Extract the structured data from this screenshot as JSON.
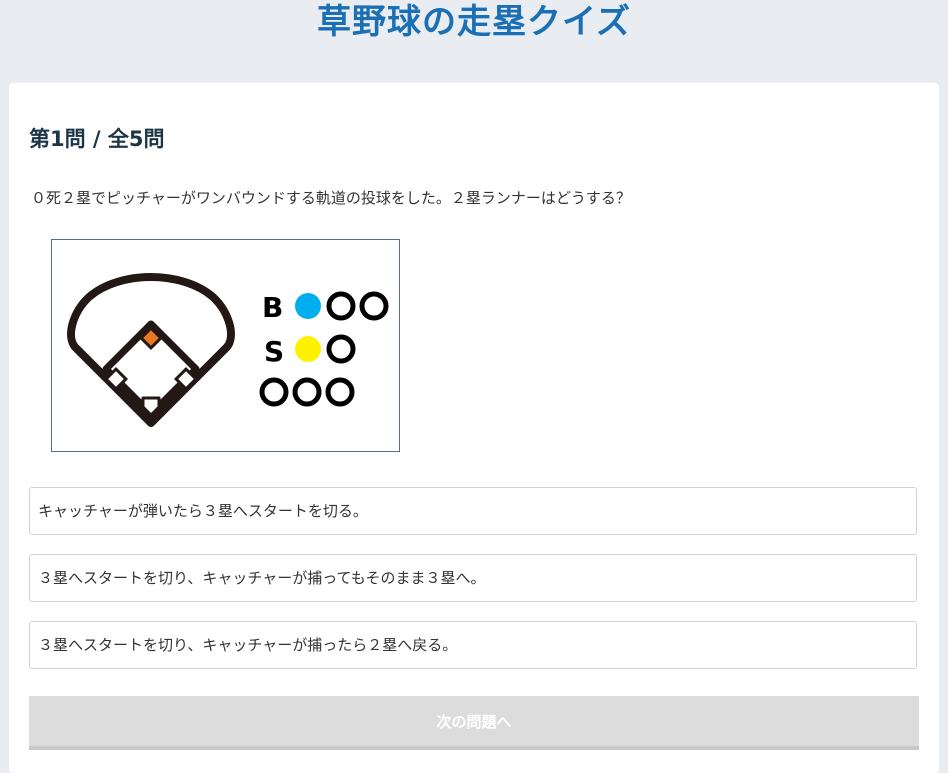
{
  "header": {
    "title": "草野球の走塁クイズ"
  },
  "quiz": {
    "question_number": "第1問 / 全5問",
    "question_text": "０死２塁でピッチャーがワンバウンドする軌道の投球をした。２塁ランナーはどうする？",
    "count": {
      "labels": {
        "balls": "B",
        "strikes": "S",
        "outs": ""
      },
      "balls": 1,
      "strikes": 1,
      "outs": 0
    },
    "runners": {
      "first": false,
      "second": true,
      "third": false
    },
    "choices": [
      {
        "label": "キャッチャーが弾いたら３塁へスタートを切る。"
      },
      {
        "label": "３塁へスタートを切り、キャッチャーが捕ってもそのまま３塁へ。"
      },
      {
        "label": "３塁へスタートを切り、キャッチャーが捕ったら２塁へ戻る。"
      }
    ],
    "next_button_label": "次の問題へ"
  },
  "colors": {
    "title": "#1a6fb5",
    "ball_lamp": "#00aeef",
    "strike_lamp": "#fff200",
    "runner_marker": "#e87722",
    "field_line": "#231815"
  }
}
